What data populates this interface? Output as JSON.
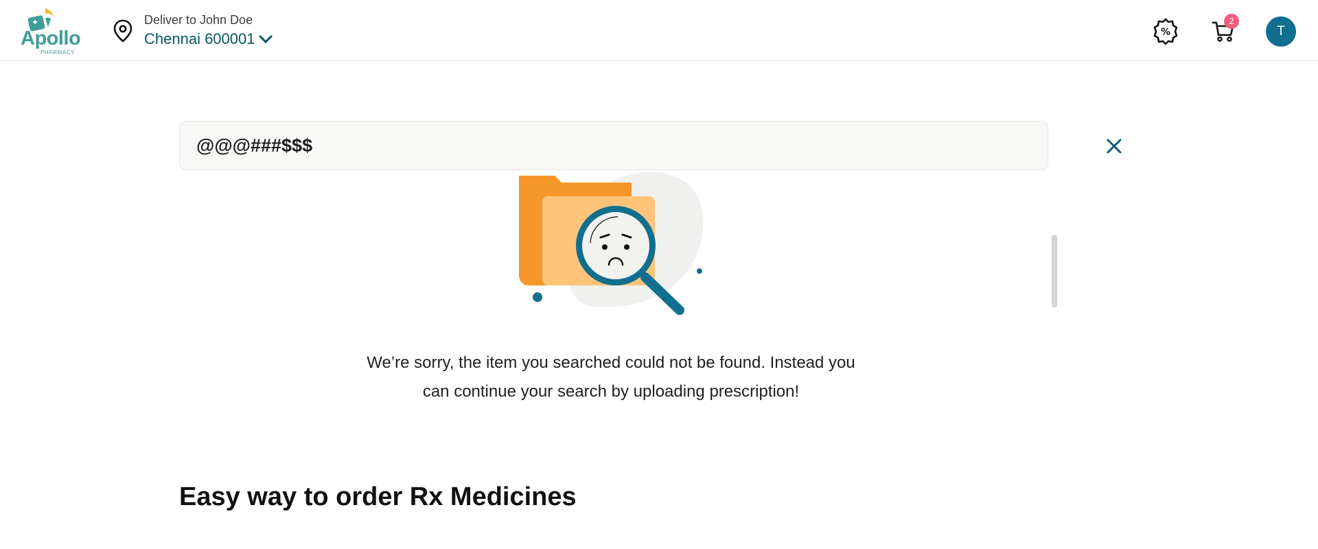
{
  "header": {
    "logo_text": "Apollo",
    "logo_subtext": "PHARMACY",
    "deliver_label": "Deliver to John Doe",
    "location": "Chennai 600001",
    "cart_count": "2",
    "avatar_initial": "T"
  },
  "search": {
    "query": "@@@###$$$"
  },
  "empty_state": {
    "message_line1": "We’re sorry, the item you searched could not be found. Instead you",
    "message_line2": "can continue your search by uploading prescription!"
  },
  "section": {
    "title": "Easy way to order Rx Medicines"
  },
  "icons": {
    "location": "location-pin-icon",
    "chevron": "chevron-down-icon",
    "offers": "discount-badge-icon",
    "cart": "cart-icon",
    "close": "close-icon"
  },
  "colors": {
    "brand_teal": "#02475b",
    "logo_teal": "#3e9e98",
    "badge_pink": "#f15d7c",
    "avatar_blue": "#106f8f",
    "folder_orange": "#f7962b"
  }
}
